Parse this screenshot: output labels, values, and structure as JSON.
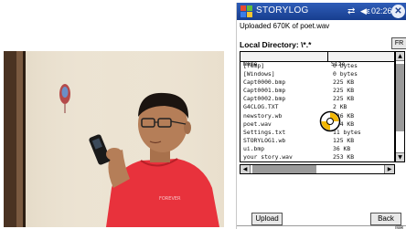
{
  "window": {
    "title": "STORYLOG",
    "time": "02:26",
    "close_label": "✕"
  },
  "status_text": "Uploaded 670K of poet.wav",
  "directory": {
    "label": "Local Directory: \\*.*",
    "side_button": "FR"
  },
  "file_list": {
    "columns": [
      "Name",
      "Size"
    ],
    "rows": [
      {
        "name": "[Temp]",
        "size": "0 bytes"
      },
      {
        "name": "[Windows]",
        "size": "0 bytes"
      },
      {
        "name": "Capt0000.bmp",
        "size": "225 KB"
      },
      {
        "name": "Capt0001.bmp",
        "size": "225 KB"
      },
      {
        "name": "Capt0002.bmp",
        "size": "225 KB"
      },
      {
        "name": "G4CLOG.TXT",
        "size": "2 KB"
      },
      {
        "name": "newstory.wb",
        "size": "126 KB"
      },
      {
        "name": "poet.wav",
        "size": "674 KB"
      },
      {
        "name": "Settings.txt",
        "size": "11 bytes"
      },
      {
        "name": "STORYLOG1.wb",
        "size": "125 KB"
      },
      {
        "name": "ui.bmp",
        "size": "36 KB"
      },
      {
        "name": "your story.wav",
        "size": "253 KB"
      }
    ]
  },
  "buttons": {
    "upload": "Upload",
    "back": "Back"
  },
  "colors": {
    "titlebar": "#1d48a3",
    "shirt": "#e8323c"
  },
  "icons": {
    "start": "windows-flag-icon",
    "connectivity": "connectivity-icon",
    "volume": "speaker-icon",
    "busy": "wait-cursor-icon"
  }
}
